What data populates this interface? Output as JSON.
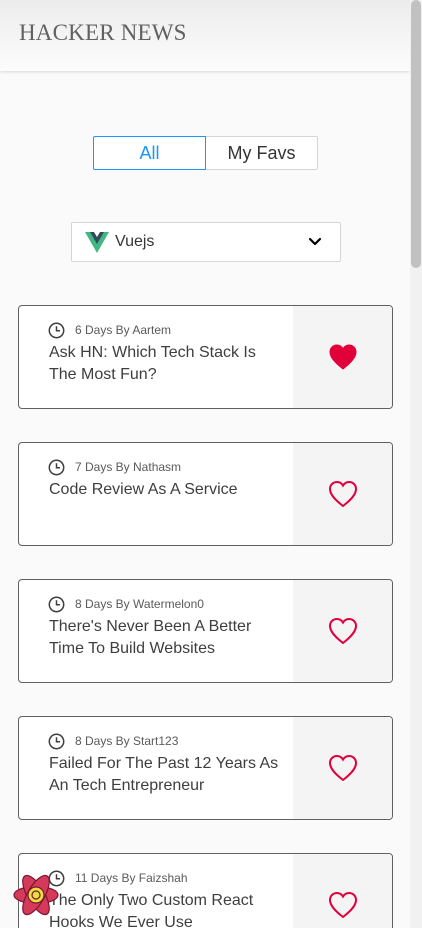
{
  "header": {
    "title": "HACKER NEWS"
  },
  "tabs": [
    {
      "label": "All",
      "active": true
    },
    {
      "label": "My Favs",
      "active": false
    }
  ],
  "filter": {
    "selected": "Vuejs",
    "logo_icon": "vue-logo-icon"
  },
  "colors": {
    "accent": "#1797ff",
    "heart": "#e2003b",
    "vue_green": "#41b883",
    "vue_dark": "#35495e",
    "react_red": "#d63a5a"
  },
  "stories": [
    {
      "meta": "6 Days By Aartem",
      "title": "Ask HN: Which Tech Stack Is The Most Fun?",
      "favorited": true
    },
    {
      "meta": "7 Days By Nathasm",
      "title": "Code Review As A Service",
      "favorited": false
    },
    {
      "meta": "8 Days By Watermelon0",
      "title": "There's Never Been A Better Time To Build Websites",
      "favorited": false
    },
    {
      "meta": "8 Days By Start123",
      "title": "Failed For The Past 12 Years As An Tech Entrepreneur",
      "favorited": false
    },
    {
      "meta": "11 Days By Faizshah",
      "title": "The Only Two Custom React Hooks We Ever Use",
      "favorited": false
    }
  ]
}
